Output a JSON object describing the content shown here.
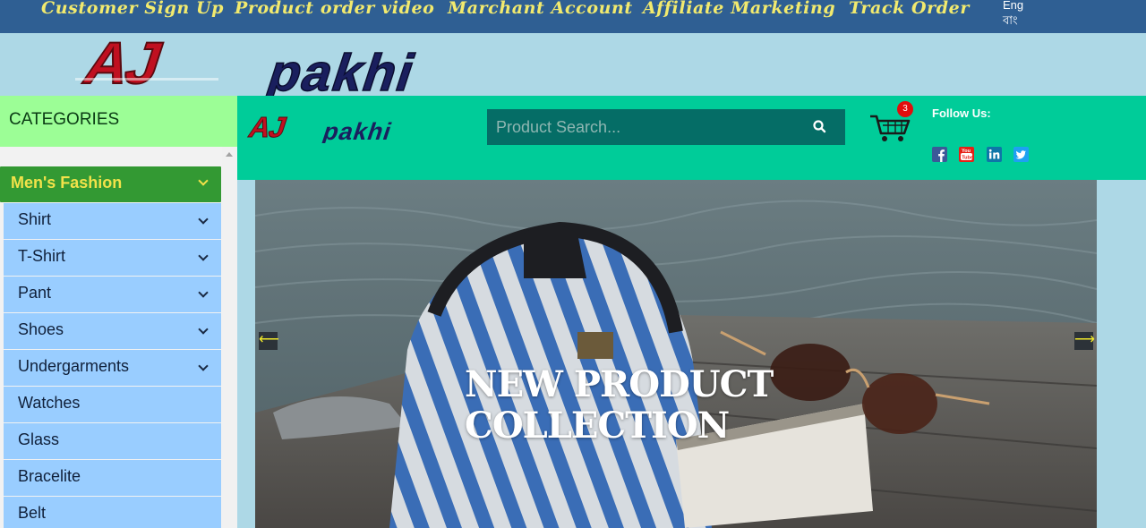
{
  "topnav": {
    "links": [
      "Customer Sign Up",
      "Product order video",
      "Marchant Account",
      "Affiliate Marketing",
      "Track Order"
    ],
    "lang": [
      "Eng",
      "বাং"
    ]
  },
  "brand": {
    "logo_text": "AJpakhi"
  },
  "sidebar": {
    "title": "CATEGORIES",
    "main_item": "Men's Fashion",
    "items": [
      {
        "label": "Shirt",
        "has_sub": true
      },
      {
        "label": "T-Shirt",
        "has_sub": true
      },
      {
        "label": "Pant",
        "has_sub": true
      },
      {
        "label": "Shoes",
        "has_sub": true
      },
      {
        "label": "Undergarments",
        "has_sub": true
      },
      {
        "label": "Watches",
        "has_sub": false
      },
      {
        "label": "Glass",
        "has_sub": false
      },
      {
        "label": "Bracelite",
        "has_sub": false
      },
      {
        "label": "Belt",
        "has_sub": false
      }
    ]
  },
  "header": {
    "search_placeholder": "Product Search...",
    "cart_count": "3",
    "follow_label": "Follow Us:",
    "social": [
      "facebook-icon",
      "youtube-icon",
      "linkedin-icon",
      "twitter-icon"
    ]
  },
  "slider": {
    "title_line1": "NEW PRODUCT",
    "title_line2": "COLLECTION",
    "prev": "⟵",
    "next": "⟶"
  },
  "colors": {
    "topnav_bg": "#2f5f93",
    "nav_link": "#f2ea6e",
    "header_bg": "#00cc99",
    "category_head": "#9cfe96",
    "menu_main": "#339933",
    "menu_item": "#99cdff",
    "logo_red": "#c01020",
    "logo_navy": "#1a1f5e"
  }
}
